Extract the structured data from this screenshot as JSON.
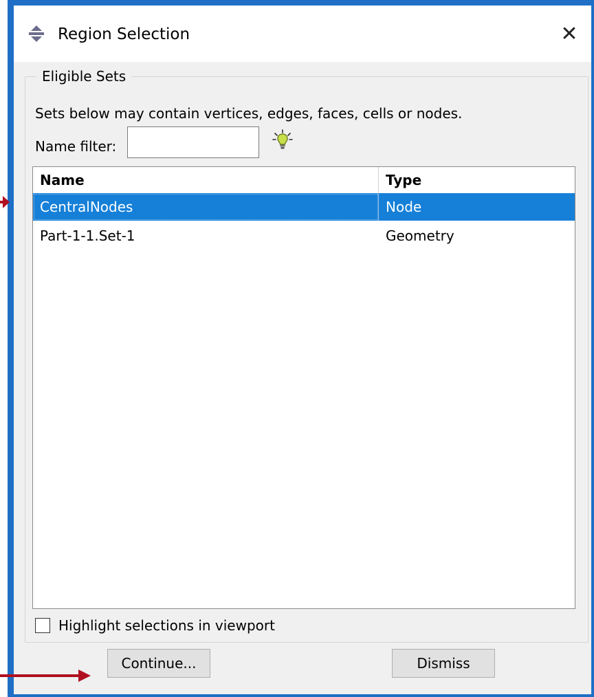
{
  "window": {
    "title": "Region Selection",
    "close_glyph": "✕"
  },
  "group": {
    "legend": "Eligible Sets",
    "description": "Sets below may contain vertices, edges, faces, cells or nodes.",
    "filter_label": "Name filter:",
    "filter_value": ""
  },
  "table": {
    "headers": {
      "name": "Name",
      "type": "Type"
    },
    "rows": [
      {
        "name": "CentralNodes",
        "type": "Node",
        "selected": true
      },
      {
        "name": "Part-1-1.Set-1",
        "type": "Geometry",
        "selected": false
      }
    ]
  },
  "highlight": {
    "label": "Highlight selections in viewport",
    "checked": false
  },
  "buttons": {
    "continue": "Continue...",
    "dismiss": "Dismiss"
  },
  "colors": {
    "frame": "#1f6fc6",
    "selection": "#1680d8",
    "annotation_arrow": "#b01020"
  },
  "icons": {
    "title": "region-selection-icon",
    "filter_hint": "lightbulb-icon"
  }
}
